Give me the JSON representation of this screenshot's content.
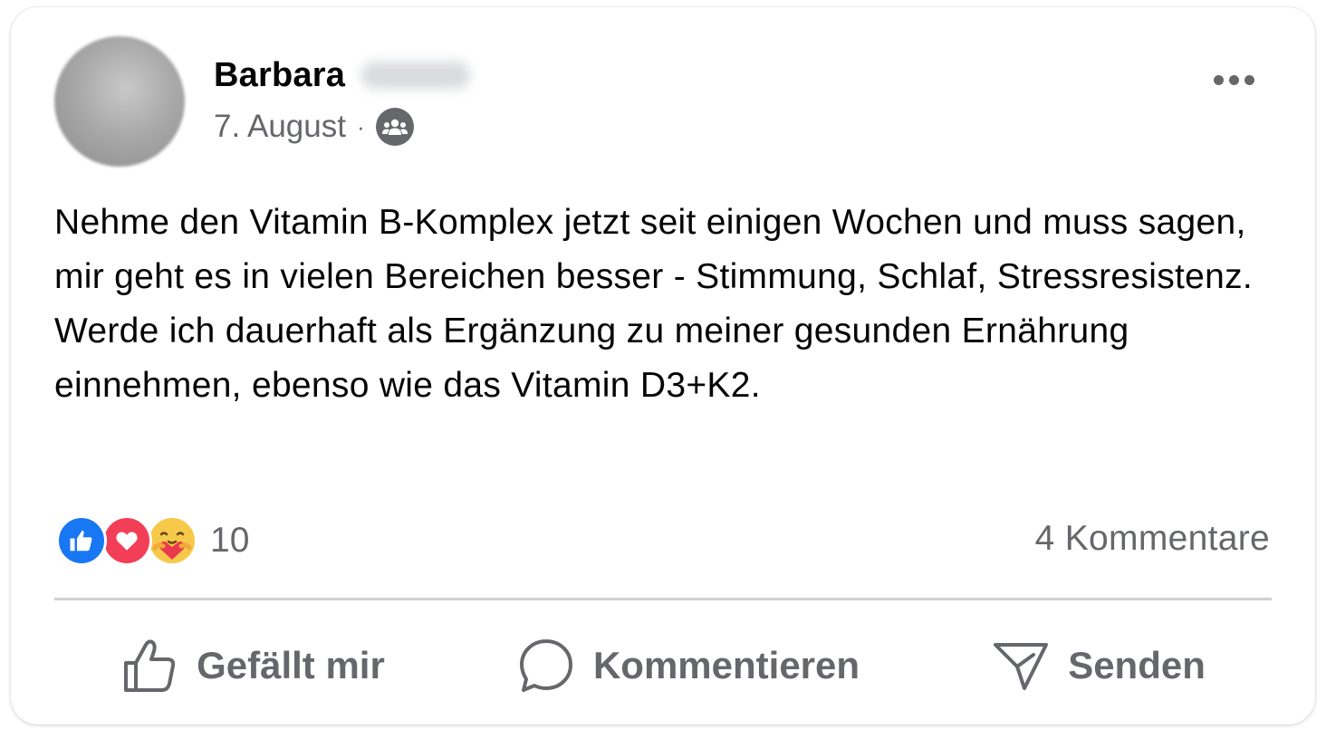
{
  "post": {
    "author_first_name": "Barbara",
    "date": "7. August",
    "separator": "·",
    "audience_icon": "friends-icon",
    "text": "Nehme den Vitamin B-Komplex jetzt seit einigen Wochen und muss sagen, mir geht es in vielen Bereichen besser - Stimmung, Schlaf, Stressresistenz. Werde ich dauerhaft als Ergänzung zu meiner gesunden Ernährung einnehmen, ebenso wie das Vitamin D3+K2."
  },
  "reactions": {
    "types": [
      "like-reaction",
      "love-reaction",
      "care-reaction"
    ],
    "count": "10"
  },
  "comments_label": "4 Kommentare",
  "actions": {
    "like_label": "Gefällt mir",
    "comment_label": "Kommentieren",
    "send_label": "Senden"
  },
  "colors": {
    "text_primary": "#050505",
    "text_secondary": "#65676b",
    "like_blue": "#1877f2",
    "love_red": "#f33e58",
    "care_yellow": "#f7c94a",
    "divider": "#ced0d4"
  }
}
